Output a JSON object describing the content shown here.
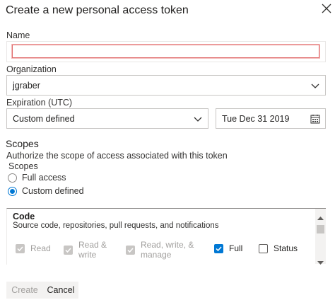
{
  "dialog": {
    "title": "Create a new personal access token"
  },
  "form": {
    "name_label": "Name",
    "name_value": "",
    "organization_label": "Organization",
    "organization_value": "jgraber",
    "expiration_label": "Expiration (UTC)",
    "expiration_value": "Custom defined",
    "expiration_date": "Tue Dec 31 2019"
  },
  "scopes": {
    "title": "Scopes",
    "description": "Authorize the scope of access associated with this token",
    "group_label": "Scopes",
    "options": [
      {
        "label": "Full access",
        "selected": false
      },
      {
        "label": "Custom defined",
        "selected": true
      }
    ]
  },
  "panel": {
    "section_title": "Code",
    "section_description": "Source code, repositories, pull requests, and notifications",
    "checkboxes": {
      "read": "Read",
      "read_write_1": "Read &",
      "read_write_2": "write",
      "rwm_1": "Read, write, &",
      "rwm_2": "manage",
      "full": "Full",
      "status": "Status"
    }
  },
  "buttons": {
    "create": "Create",
    "cancel": "Cancel"
  },
  "icons": {
    "close": "close-icon",
    "chevron": "chevron-down-icon",
    "calendar": "calendar-icon"
  },
  "colors": {
    "accent": "#0078d4",
    "error_border": "#e06c6c"
  }
}
